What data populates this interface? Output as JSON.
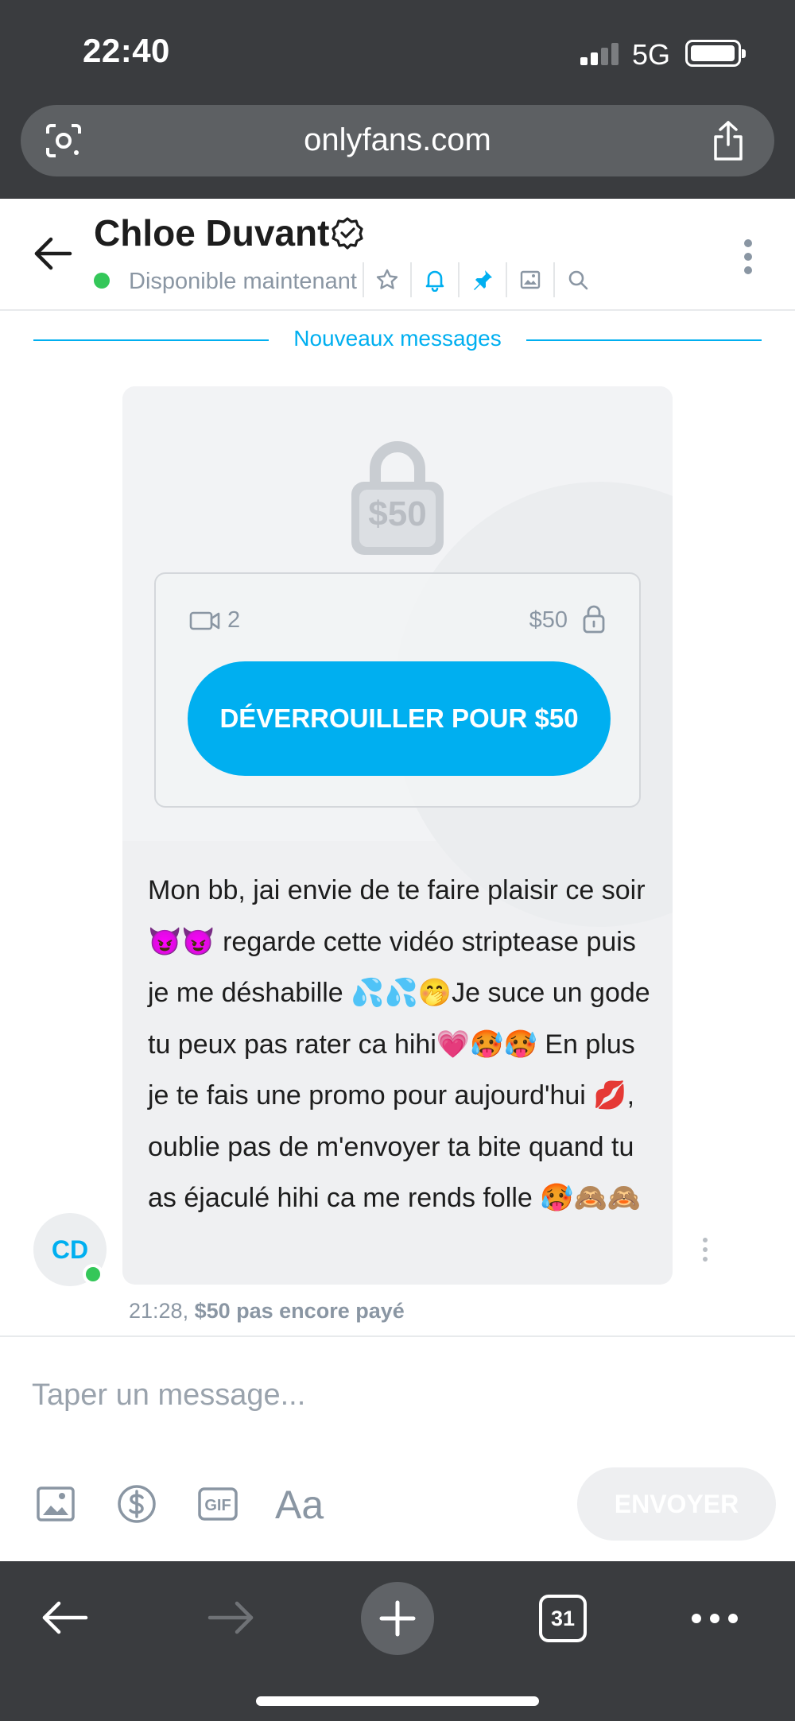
{
  "status_bar": {
    "time": "22:40",
    "network": "5G"
  },
  "browser": {
    "url": "onlyfans.com",
    "tab_count": "31"
  },
  "chat_header": {
    "name": "Chloe Duvant",
    "status": "Disponible maintenant",
    "header_icons": [
      "star-icon",
      "bell-icon",
      "pin-icon",
      "gallery-icon",
      "search-icon"
    ]
  },
  "divider": {
    "label": "Nouveaux messages"
  },
  "message": {
    "lock_price": "$50",
    "video_count": "2",
    "card_price": "$50",
    "unlock_button": "DÉVERROUILLER POUR $50",
    "text": "Mon bb, jai envie de te faire plaisir ce soir 😈😈 regarde cette vidéo striptease puis je me déshabille 💦💦🤭Je suce un gode tu peux pas rater ca hihi💗🥵🥵 En plus je te fais une promo pour aujourd'hui 💋, oublie pas de m'envoyer ta bite quand tu as éjaculé hihi ca me rends folle 🥵🙈🙈",
    "time": "21:28,",
    "payment_status": "$50 pas encore payé"
  },
  "avatar": {
    "initials": "CD"
  },
  "composer": {
    "placeholder": "Taper un message...",
    "text_format_label": "Aa",
    "send_label": "ENVOYER"
  },
  "colors": {
    "accent": "#00aff0",
    "online": "#34c759",
    "chrome": "#3a3c3f",
    "bubble": "#eff0f2",
    "muted_text": "#8a96a3"
  }
}
